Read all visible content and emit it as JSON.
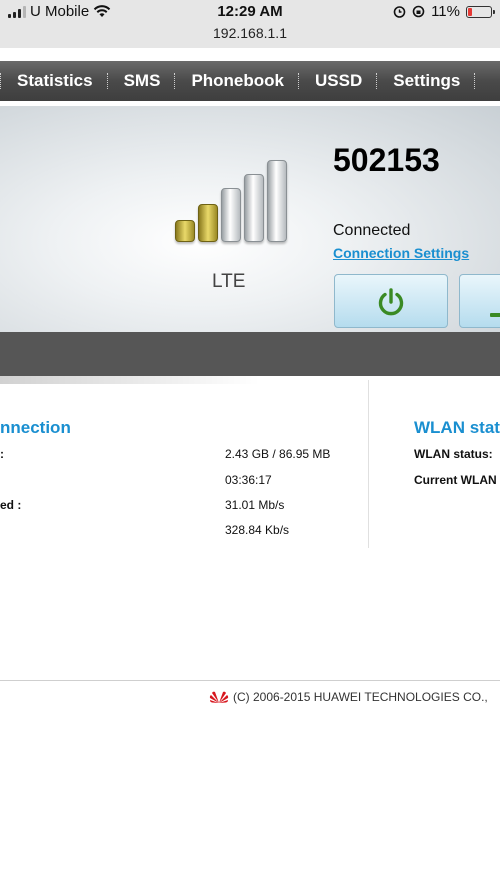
{
  "status_bar": {
    "carrier": "U Mobile",
    "time": "12:29 AM",
    "battery": "11%",
    "url": "192.168.1.1"
  },
  "nav": {
    "items": [
      "Statistics",
      "SMS",
      "Phonebook",
      "USSD",
      "Settings"
    ]
  },
  "hero": {
    "device_id": "502153",
    "network_type": "LTE",
    "signal_bars_active": 2,
    "signal_bars_total": 5,
    "connection_status": "Connected",
    "connection_settings_link": "Connection Settings"
  },
  "connection": {
    "title": "nnection",
    "rows": [
      {
        "label": ":",
        "value": "2.43 GB /  86.95 MB"
      },
      {
        "label": "",
        "value": "03:36:17"
      },
      {
        "label": "ed :",
        "value": "31.01 Mb/s"
      },
      {
        "label": "",
        "value": "328.84 Kb/s"
      }
    ]
  },
  "wlan": {
    "title": "WLAN stat",
    "status_label": "WLAN status:",
    "current_label": "Current WLAN"
  },
  "footer": {
    "copyright": "(C) 2006-2015 HUAWEI TECHNOLOGIES CO.,"
  },
  "colors": {
    "accent": "#1a8fd0",
    "power_icon": "#3a8a24",
    "nav_bg": "#4a4a4a"
  }
}
